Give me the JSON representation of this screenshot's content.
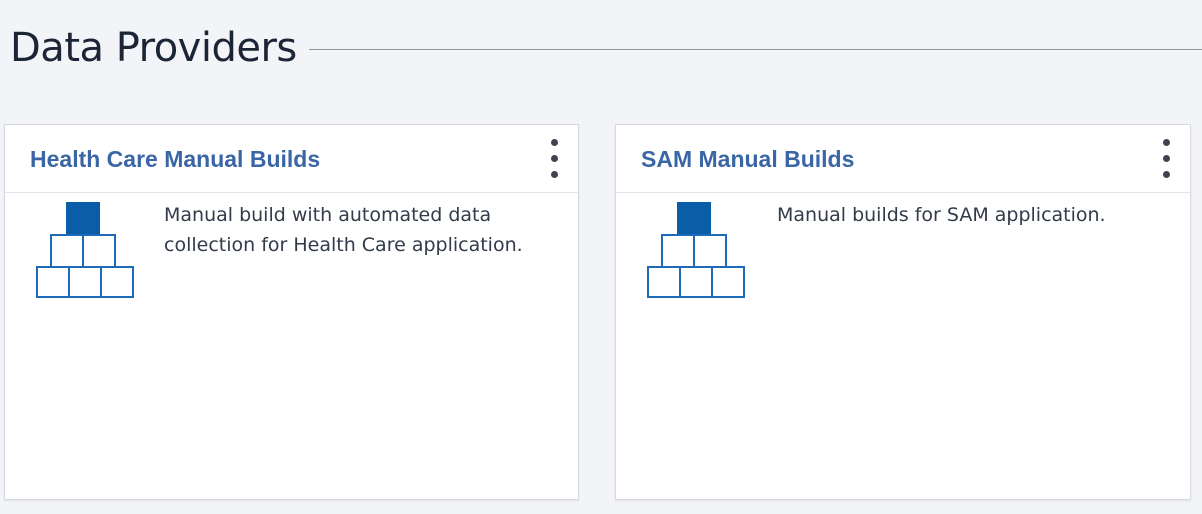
{
  "page": {
    "title": "Data Providers"
  },
  "cards": [
    {
      "title": "Health Care Manual Builds",
      "description": "Manual build with automated data collection for Health Care application.",
      "icon": "pyramid-build-icon",
      "menu_icon": "kebab-menu-icon"
    },
    {
      "title": "SAM Manual Builds",
      "description": "Manual builds for SAM application.",
      "icon": "pyramid-build-icon",
      "menu_icon": "kebab-menu-icon"
    }
  ],
  "colors": {
    "background": "#f3f4f8",
    "card_title": "#3a66a5",
    "icon_fill": "#0a5ea7",
    "icon_outline": "#1c6ab8",
    "text": "#323b4a"
  }
}
